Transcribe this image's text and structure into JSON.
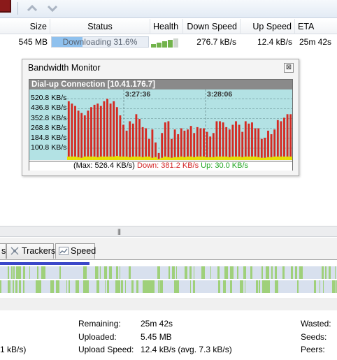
{
  "toolbar": {
    "icons": [
      "app-red-icon",
      "up-arrow-icon",
      "down-arrow-icon"
    ],
    "up_glyph": "⌃",
    "down_glyph": "⌄"
  },
  "columns": {
    "size": "Size",
    "status": "Status",
    "health": "Health",
    "down_speed": "Down Speed",
    "up_speed": "Up Speed",
    "eta": "ETA"
  },
  "torrent": {
    "size": "545 MB",
    "status": "Downloading 31.6%",
    "progress": 0.316,
    "health_bars": 4,
    "down_speed": "276.7 kB/s",
    "up_speed": "12.4 kB/s",
    "eta": "25m 42s"
  },
  "bandwidth_monitor": {
    "title": "Bandwidth Monitor",
    "close_glyph": "⊠",
    "connection": "Dial-up Connection [10.41.176.7]",
    "legend": {
      "max": "(Max: 526.4 KB/s)",
      "down": "Down: 381.2 KB/s",
      "up": "Up: 30.0 KB/s"
    },
    "colors": {
      "down": "#d42a22",
      "up": "#e8e000",
      "background": "#b3e2e4"
    }
  },
  "chart_data": {
    "type": "bar",
    "y_ticks": [
      "520.8 KB/s",
      "436.8 KB/s",
      "352.8 KB/s",
      "268.8 KB/s",
      "184.8 KB/s",
      "100.8 KB/s"
    ],
    "time_labels": [
      "3:27:36",
      "3:28:06"
    ],
    "ylim": [
      0,
      600
    ],
    "grid": true,
    "series": [
      {
        "name": "Down",
        "values": [
          500,
          480,
          460,
          420,
          400,
          380,
          420,
          450,
          470,
          480,
          460,
          500,
          520,
          480,
          500,
          450,
          380,
          300,
          250,
          330,
          310,
          390,
          350,
          280,
          270,
          180,
          260,
          150,
          60,
          230,
          320,
          330,
          180,
          260,
          220,
          270,
          250,
          260,
          290,
          230,
          280,
          270,
          270,
          240,
          200,
          230,
          330,
          330,
          320,
          280,
          260,
          300,
          330,
          300,
          240,
          330,
          310,
          320,
          270,
          270,
          180,
          190,
          250,
          220,
          260,
          340,
          330,
          360,
          390,
          390
        ]
      },
      {
        "name": "Up",
        "values": [
          30,
          30,
          30,
          25,
          20,
          30,
          30,
          30,
          30,
          25,
          30,
          30,
          30,
          30,
          30,
          35,
          30,
          30,
          30,
          25,
          30,
          30,
          30,
          25,
          30,
          30,
          20,
          25,
          10,
          20,
          30,
          25,
          20,
          25,
          25,
          30,
          25,
          30,
          30,
          25,
          30,
          30,
          30,
          25,
          25,
          25,
          30,
          30,
          30,
          30,
          25,
          30,
          30,
          30,
          25,
          30,
          30,
          30,
          30,
          25,
          20,
          20,
          25,
          25,
          30,
          30,
          30,
          30,
          30,
          30
        ]
      }
    ]
  },
  "splitter": {
    "grip": "|||"
  },
  "tabs": {
    "partial": "s",
    "trackers": "Trackers",
    "speed": "Speed"
  },
  "info": {
    "left_fragment": "1 kB/s)",
    "remaining_label": "Remaining:",
    "remaining_value": "25m 42s",
    "uploaded_label": "Uploaded:",
    "uploaded_value": "5.45 MB",
    "upload_speed_label": "Upload Speed:",
    "upload_speed_value": "12.4 kB/s (avg. 7.3 kB/s)",
    "wasted_label": "Wasted:",
    "seeds_label": "Seeds:",
    "peers_label": "Peers:"
  }
}
